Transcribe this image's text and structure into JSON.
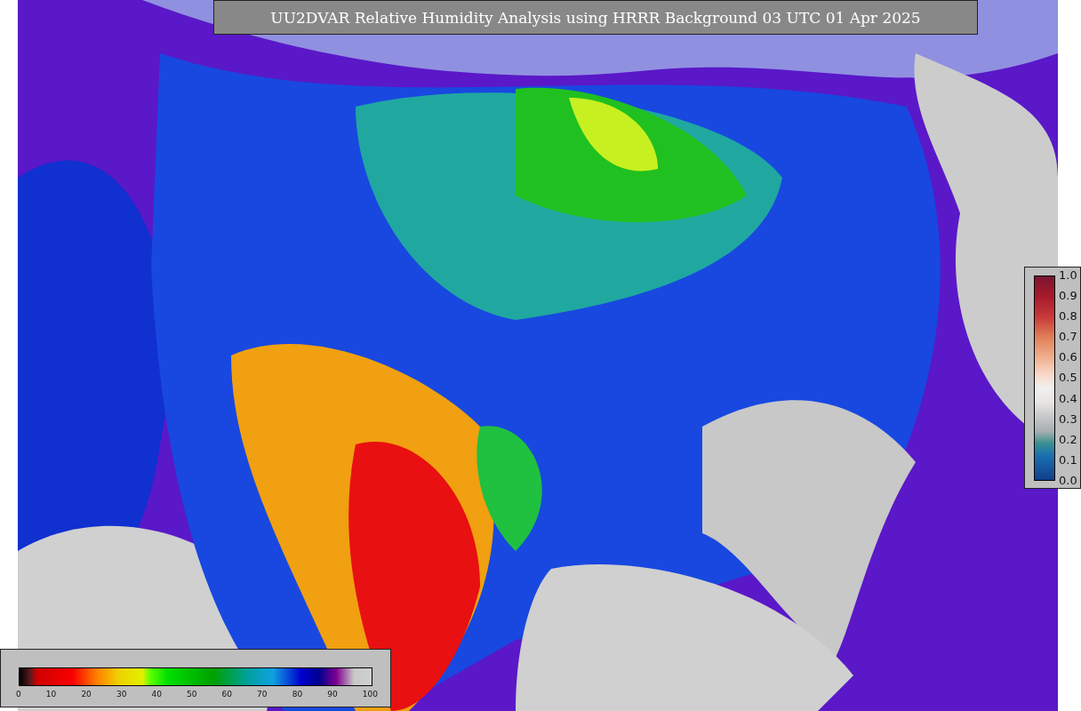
{
  "title": "UU2DVAR Relative Humidity Analysis using HRRR Background 03 UTC 01 Apr 2025",
  "side_colorbar": {
    "ticks": [
      "1.0",
      "0.9",
      "0.8",
      "0.7",
      "0.6",
      "0.5",
      "0.4",
      "0.3",
      "0.2",
      "0.1",
      "0.0"
    ]
  },
  "bottom_colorbar": {
    "ticks": [
      "0",
      "10",
      "20",
      "30",
      "40",
      "50",
      "60",
      "70",
      "80",
      "90",
      "100"
    ]
  }
}
